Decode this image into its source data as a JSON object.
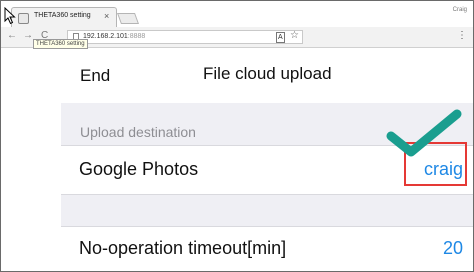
{
  "browser": {
    "tab_title": "THETA360 setting",
    "tab_close": "×",
    "user_label": "Craig",
    "tooltip": "THETA360 setting",
    "url_host": "192.168.2.101",
    "url_port": ":8888",
    "back": "←",
    "forward": "→",
    "reload": "C",
    "translate": "A",
    "star": "☆",
    "menu": "⋮"
  },
  "header": {
    "end_label": "End",
    "title": "File cloud upload"
  },
  "upload": {
    "section_label": "Upload destination",
    "destination_label": "Google Photos",
    "destination_value": "craig"
  },
  "timeout": {
    "label": "No-operation timeout[min]",
    "value": "20"
  },
  "colors": {
    "accent_blue": "#1e88e5",
    "annotation_red": "#e53935",
    "check_teal": "#1a9e8f"
  }
}
